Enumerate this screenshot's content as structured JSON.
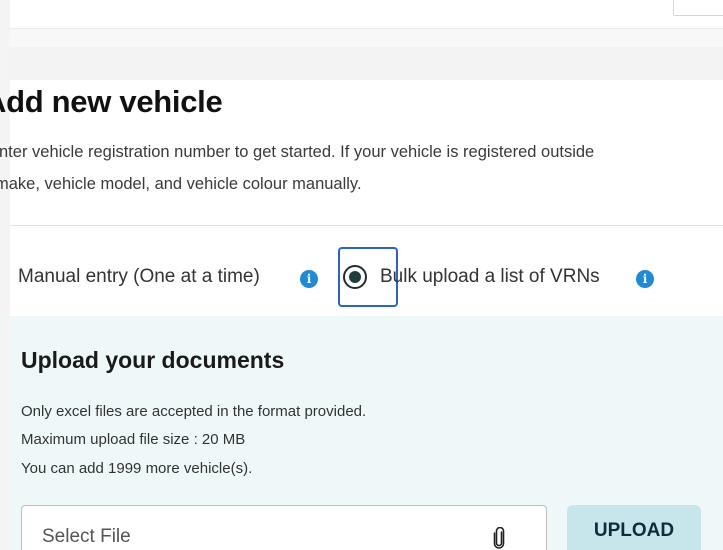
{
  "heading": "Add new vehicle",
  "description": {
    "line1": "Enter vehicle registration number to get started. If your vehicle is registered outside",
    "line2": "make, vehicle model, and vehicle colour manually."
  },
  "entry_options": {
    "manual_label": "Manual entry (One at a time)",
    "bulk_label": "Bulk upload a list of VRNs",
    "selected": "bulk",
    "info_glyph": "i"
  },
  "upload": {
    "title": "Upload your documents",
    "notes": [
      "Only excel files are accepted in the format provided.",
      "Maximum upload file size : 20 MB",
      "You can add 1999 more vehicle(s)."
    ],
    "file_placeholder": "Select File",
    "button_label": "UPLOAD"
  },
  "icons": {
    "info": "info-icon",
    "attachment": "paperclip-icon"
  },
  "colors": {
    "info_blue": "#1d8bd8",
    "focus_ring": "#2a64c9",
    "panel_bg": "#eef8f8",
    "upload_button_bg": "#c6e6ec"
  }
}
